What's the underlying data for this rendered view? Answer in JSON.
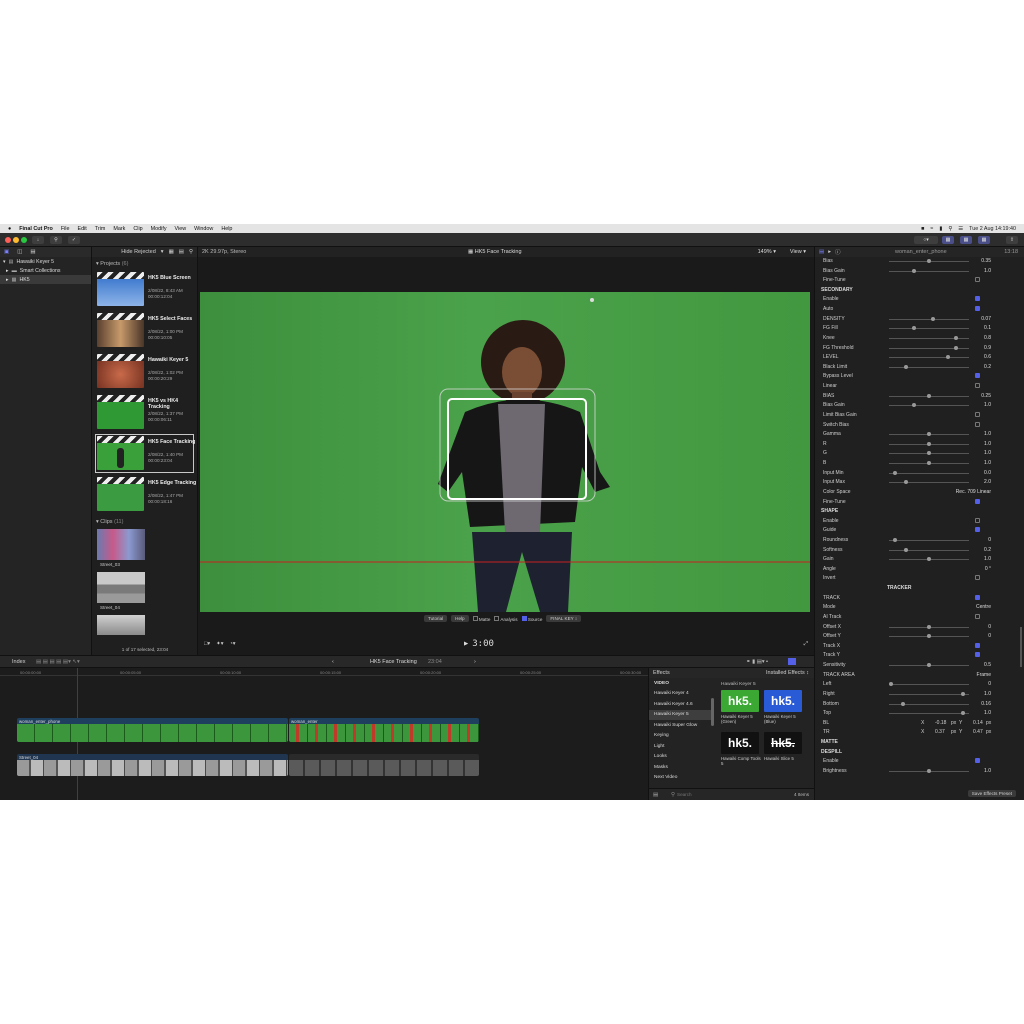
{
  "menubar": {
    "app_name": "Final Cut Pro",
    "items": [
      "File",
      "Edit",
      "Trim",
      "Mark",
      "Clip",
      "Modify",
      "View",
      "Window",
      "Help"
    ],
    "datetime": "Tue 2 Aug  14:19:40"
  },
  "libraries": {
    "items": [
      {
        "label": "Hawaiki Keyer 5",
        "icon": "library-icon"
      },
      {
        "label": "Smart Collections",
        "icon": "folder-icon"
      },
      {
        "label": "HK5",
        "icon": "event-icon"
      }
    ]
  },
  "browser": {
    "filter_label": "Hide Rejected",
    "projects_title": "Projects",
    "projects_count": "(6)",
    "projects": [
      {
        "name": "HK5 Blue Screen",
        "date": "2/08/22, 8:43 AM",
        "duration": "00:00:12:04"
      },
      {
        "name": "HK5 Select Faces",
        "date": "2/08/22, 1:00 PM",
        "duration": "00:00:10:05"
      },
      {
        "name": "Hawaiki Keyer 5",
        "date": "2/08/22, 1:02 PM",
        "duration": "00:00:20:29"
      },
      {
        "name": "HK5 vs HK4 Tracking",
        "date": "2/08/22, 1:37 PM",
        "duration": "00:00:06:11"
      },
      {
        "name": "HK5 Face Tracking",
        "date": "2/08/22, 1:40 PM",
        "duration": "00:00:23:04"
      },
      {
        "name": "HK5 Edge Tracking",
        "date": "2/08/22, 1:47 PM",
        "duration": "00:00:18:16"
      }
    ],
    "clips_title": "Clips",
    "clips_count": "(11)",
    "clips": [
      {
        "name": "Street_03"
      },
      {
        "name": "Street_04"
      }
    ],
    "status": "1 of 17 selected, 23:04"
  },
  "viewer": {
    "format": "2K 29.97p, Stereo",
    "title": "HK5 Face Tracking",
    "zoom": "149%",
    "view_label": "View",
    "overlay_buttons": [
      "Tutorial",
      "Help"
    ],
    "overlay_checks": [
      {
        "label": "Matte",
        "on": false
      },
      {
        "label": "Analysis",
        "on": false
      },
      {
        "label": "Source",
        "on": true
      }
    ],
    "final_key": "FINAL KEY",
    "timecode": "3:00"
  },
  "timeline_bar": {
    "index_label": "Index",
    "project": "HK5 Face Tracking",
    "duration": "23:04"
  },
  "timeline": {
    "ruler": [
      "00:00:00:00",
      "00:00:05:00",
      "00:00:10:00",
      "00:00:15:00",
      "00:00:20:00",
      "00:00:25:00",
      "00:00:30:00"
    ],
    "clip_a": "woman_enter_phone",
    "clip_b": "woman_enter",
    "clip_c": "Street_04"
  },
  "effects": {
    "header": "Effects",
    "installed_label": "Installed Effects",
    "categories": [
      "VIDEO",
      "Hawaiki Keyer 4",
      "Hawaiki Keyer 4.6",
      "Hawaiki Keyer 5",
      "Hawaiki Super Glow",
      "Keying",
      "Light",
      "Looks",
      "Masks",
      "Next Video"
    ],
    "selected_category": "Hawaiki Keyer 5",
    "group_title": "Hawaiki Keyer 5",
    "tiles": [
      {
        "logo": "hk5.",
        "label": "Hawaiki Keyer 5 (Green)",
        "color": "#3aa832"
      },
      {
        "logo": "hk5.",
        "label": "Hawaiki Keyer 5 (Blue)",
        "color": "#2a5bd7"
      },
      {
        "logo": "hk5.",
        "label": "Hawaiki Comp Tools 5",
        "color": "#111111"
      },
      {
        "logo": "hk5.",
        "label": "Hawaiki Slice 5",
        "color": "#111111"
      }
    ],
    "search_placeholder": "Search",
    "count": "4 Items"
  },
  "inspector": {
    "clip_name": "woman_enter_phone",
    "time": "13:18",
    "rows": [
      {
        "label": "Bias",
        "val": "0.35",
        "knob": 0.5
      },
      {
        "label": "Bias Gain",
        "val": "1.0",
        "knob": 0.3
      },
      {
        "label": "Fine-Tune",
        "check": false
      },
      {
        "section": "SECONDARY"
      },
      {
        "label": "Enable",
        "check": true
      },
      {
        "label": "Auto",
        "check": true
      },
      {
        "label": "DENSITY",
        "val": "0.07",
        "knob": 0.55
      },
      {
        "label": "FG Fill",
        "val": "0.1",
        "knob": 0.3
      },
      {
        "label": "Knee",
        "val": "0.8",
        "knob": 0.85
      },
      {
        "label": "FG Threshold",
        "val": "0.9",
        "knob": 0.85
      },
      {
        "label": "LEVEL",
        "val": "0.6",
        "knob": 0.75
      },
      {
        "label": "Black Limit",
        "val": "0.2",
        "knob": 0.2
      },
      {
        "label": "Bypass Level",
        "check": true
      },
      {
        "label": "Linear",
        "check": false
      },
      {
        "label": "BIAS",
        "val": "0.25",
        "knob": 0.5
      },
      {
        "label": "Bias Gain",
        "val": "1.0",
        "knob": 0.3
      },
      {
        "label": "Limit Bias Gain",
        "check": false
      },
      {
        "label": "Switch Bias",
        "check": false
      },
      {
        "label": "Gamma",
        "val": "1.0",
        "knob": 0.5
      },
      {
        "label": "R",
        "val": "1.0",
        "knob": 0.5
      },
      {
        "label": "G",
        "val": "1.0",
        "knob": 0.5
      },
      {
        "label": "B",
        "val": "1.0",
        "knob": 0.5
      },
      {
        "label": "Input Min",
        "val": "0.0",
        "knob": 0.05
      },
      {
        "label": "Input Max",
        "val": "2.0",
        "knob": 0.2
      },
      {
        "label": "Color Space",
        "val": "Rec. 709 Linear"
      },
      {
        "label": "Fine-Tune",
        "check": true
      },
      {
        "section": "SHAPE"
      },
      {
        "label": "Enable",
        "check": false
      },
      {
        "label": "Guide",
        "check": true
      },
      {
        "label": "Roundness",
        "val": "0",
        "knob": 0.05
      },
      {
        "label": "Softness",
        "val": "0.2",
        "knob": 0.2
      },
      {
        "label": "Gain",
        "val": "1.0",
        "knob": 0.5
      },
      {
        "label": "Angle",
        "val": "0 °"
      },
      {
        "label": "Invert",
        "check": false
      },
      {
        "section": "TRACKER",
        "center": true
      },
      {
        "label": "TRACK",
        "check": true
      },
      {
        "label": "Mode",
        "val": "Centre"
      },
      {
        "label": "AI Track",
        "check": false
      },
      {
        "label": "Offset X",
        "val": "0",
        "knob": 0.5
      },
      {
        "label": "Offset Y",
        "val": "0",
        "knob": 0.5
      },
      {
        "label": "Track X",
        "check": true
      },
      {
        "label": "Track Y",
        "check": true
      },
      {
        "label": "Sensitivity",
        "val": "0.5",
        "knob": 0.5
      },
      {
        "label": "TRACK AREA",
        "val": "Frame"
      },
      {
        "label": "Left",
        "val": "0",
        "knob": 0.0
      },
      {
        "label": "Right",
        "val": "1.0",
        "knob": 0.95
      },
      {
        "label": "Bottom",
        "val": "0.16",
        "knob": 0.16
      },
      {
        "label": "Top",
        "val": "1.0",
        "knob": 0.95
      },
      {
        "label": "BL",
        "xv": "-0.18",
        "yv": "0.14",
        "unit": "px"
      },
      {
        "label": "TR",
        "xv": "0.37",
        "yv": "0.47",
        "unit": "px"
      },
      {
        "section": "MATTE"
      },
      {
        "section": "DESPILL"
      },
      {
        "label": "Enable",
        "check": true
      },
      {
        "label": "Brightness",
        "val": "1.0",
        "knob": 0.5
      }
    ],
    "save_preset": "Save Effects Preset"
  }
}
